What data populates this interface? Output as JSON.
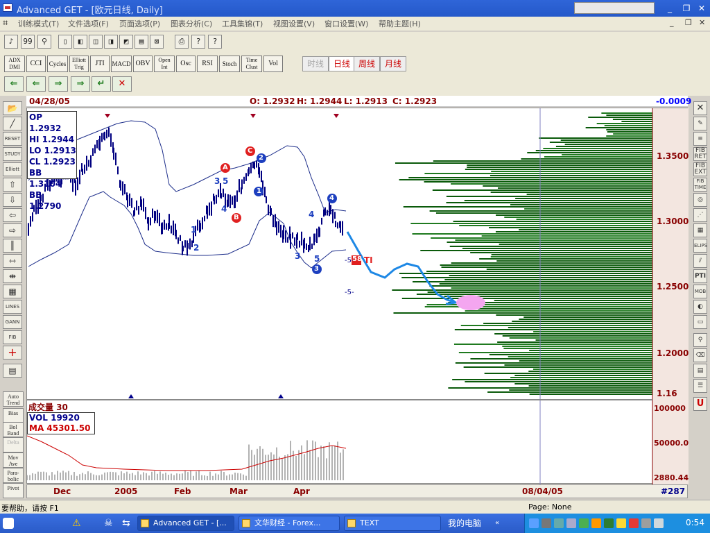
{
  "window": {
    "title": "Advanced GET - [欧元日线, Daily]"
  },
  "menu": [
    "训练模式(T)",
    "文件选项(F)",
    "页面选项(P)",
    "图表分析(C)",
    "工具集锦(T)",
    "视图设置(V)",
    "窗口设置(W)",
    "帮助主题(H)"
  ],
  "toolbar1": [
    "♪",
    "99",
    "⚲",
    "▯",
    "◧",
    "◫",
    "◨",
    "◩",
    "▤",
    "⊠",
    "◪",
    "⎙",
    "?",
    "?"
  ],
  "indicators": [
    "ADX DMI",
    "CCI",
    "Cycles",
    "Elliott Trig",
    "JTI",
    "MACD",
    "OBV",
    "Open Int",
    "Osc",
    "RSI",
    "Stoch",
    "Time Clust",
    "Vol"
  ],
  "periods": [
    "时线",
    "日线",
    "周线",
    "月线"
  ],
  "nav_buttons": [
    "⇐",
    "⇐",
    "⇒",
    "⇒",
    "↵",
    "✕"
  ],
  "info": {
    "date": "04/28/05",
    "open": "O: 1.2932",
    "high": "H: 1.2944",
    "low": "L: 1.2913",
    "close": "C: 1.2923",
    "change": "-0.0009"
  },
  "ohlc_box": [
    "OP 1.2932",
    "HI  1.2944",
    "LO  1.2913",
    "CL  1.2923",
    "BB  1.3104",
    "BB  1.2790"
  ],
  "volume_panel": {
    "title": "成交量 30",
    "vol": "VOL 19920",
    "ma": "MA  45301.50",
    "axis": [
      "100000",
      "50000.0",
      "2880.44"
    ]
  },
  "price_axis": [
    "1.3500",
    "1.3000",
    "1.2500",
    "1.2000",
    "1.16"
  ],
  "chart_labels": {
    "wave_A": "A",
    "wave_B": "B",
    "wave_C": "C",
    "w1": "1",
    "w2": "2",
    "w3": "3",
    "w4": "4",
    "w5": "5",
    "neg5a": "-5-",
    "neg5b": "-5-",
    "ti": "58",
    "ti_text": "TI"
  },
  "dates": [
    "Dec",
    "2005",
    "Feb",
    "Mar",
    "Apr",
    "08/04/05",
    "#287"
  ],
  "left_tools": [
    "RESET",
    "STUDY",
    "Elliott",
    "LINES",
    "GANN",
    "FIB"
  ],
  "left_indicators": [
    "Auto Trend",
    "Bias",
    "Bol Band",
    "Delta",
    "Mov Ave",
    "Para- bolic",
    "Pivot"
  ],
  "right_tools": [
    "FIB RET",
    "FIB EXT",
    "FIB TIME",
    "ELIPS",
    "PTI",
    "MOB"
  ],
  "status": {
    "help": "要帮助，请按 F1",
    "page": "Page: None"
  },
  "taskbar": {
    "tasks": [
      "Advanced GET - [...",
      "文华财经 - Forex...",
      "TEXT"
    ],
    "computer": "我的电脑",
    "time": "0:54"
  },
  "colors": {
    "accent": "#2458c9",
    "bars": "#000080",
    "profile": "#0a5a0a",
    "arrow": "#1e88e5",
    "target": "#f4a6f0",
    "label_red": "#e02020",
    "label_blue": "#1d3fbf"
  }
}
